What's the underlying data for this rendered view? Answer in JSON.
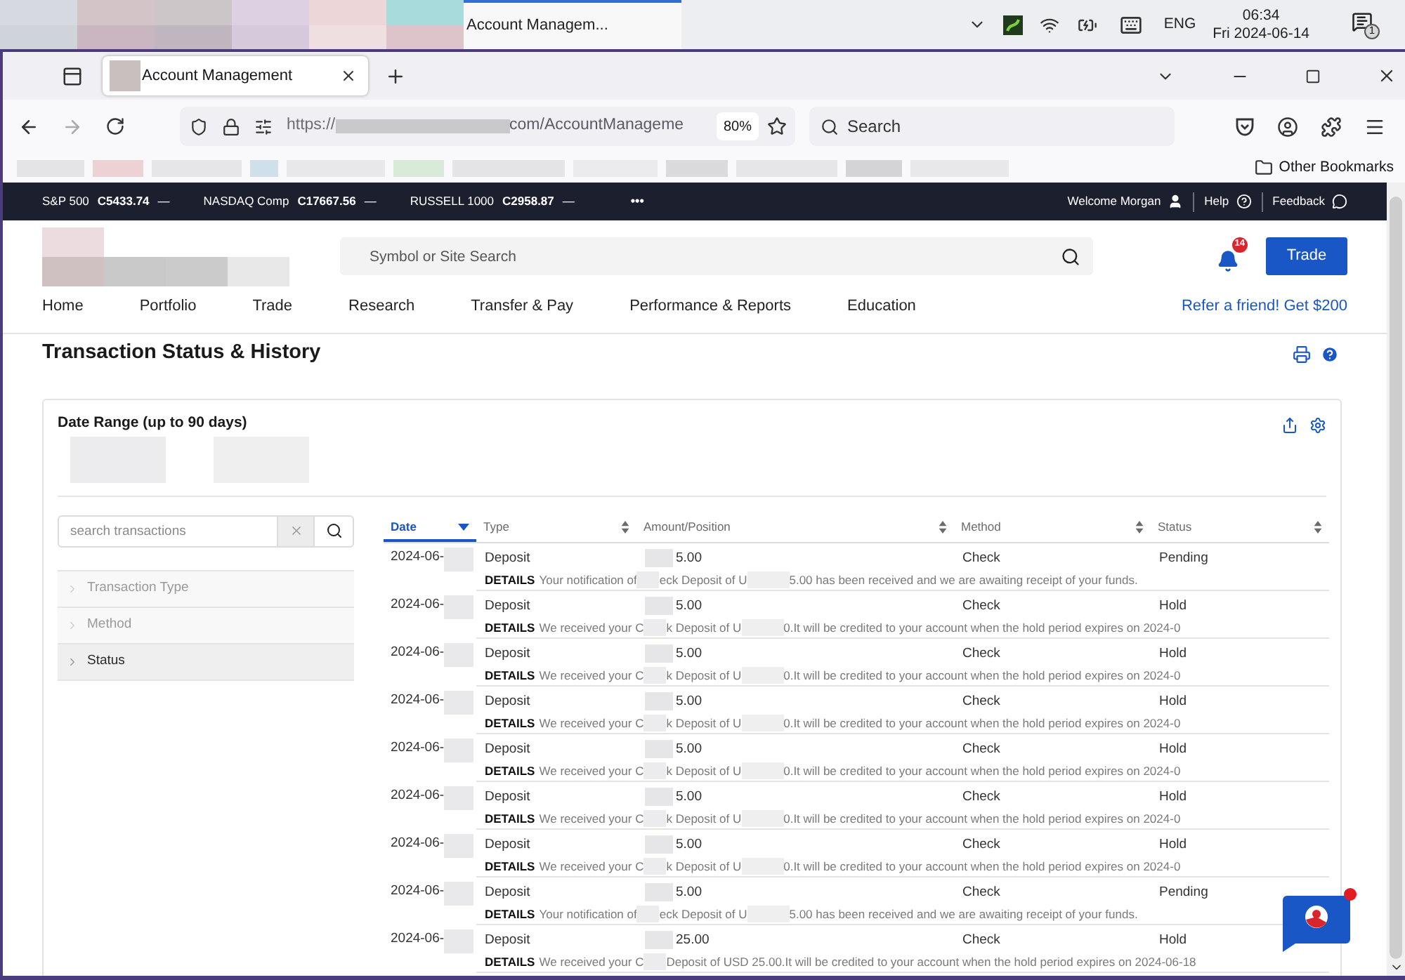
{
  "taskbar": {
    "app_button": "Account Managem...",
    "language": "ENG",
    "time": "06:34",
    "date": "Fri 2024-06-14",
    "notification_count": "1"
  },
  "browser": {
    "tab": {
      "title": "Account Management",
      "selected": true
    },
    "address": {
      "scheme": "https://",
      "path": "com/AccountManageme"
    },
    "zoom": "80%",
    "search_placeholder": "Search",
    "bookmarks": {
      "folder": "Other Bookmarks"
    }
  },
  "ticker": {
    "quotes": [
      {
        "name": "S&P 500",
        "value": "C5433.74",
        "change": "—"
      },
      {
        "name": "NASDAQ Comp",
        "value": "C17667.56",
        "change": "—"
      },
      {
        "name": "RUSSELL 1000",
        "value": "C2958.87",
        "change": "—"
      }
    ],
    "more": "•••"
  },
  "utility_links": {
    "welcome": "Welcome Morgan",
    "help": "Help",
    "feedback": "Feedback"
  },
  "header": {
    "search_placeholder": "Symbol or Site Search",
    "alert_count": "14",
    "trade_button": "Trade"
  },
  "nav": {
    "items": [
      "Home",
      "Portfolio",
      "Trade",
      "Research",
      "Transfer & Pay",
      "Performance & Reports",
      "Education"
    ],
    "promo": "Refer a friend! Get $200"
  },
  "page": {
    "title": "Transaction Status & History"
  },
  "filters": {
    "date_range_label": "Date Range (up to 90 days)",
    "search_placeholder": "search transactions",
    "facets": [
      {
        "label": "Transaction Type",
        "disabled": true
      },
      {
        "label": "Method",
        "disabled": true
      },
      {
        "label": "Status",
        "disabled": false
      }
    ]
  },
  "table": {
    "columns": [
      {
        "label": "Date",
        "selected": true
      },
      {
        "label": "Type",
        "selected": false
      },
      {
        "label": "Amount/Position",
        "selected": false
      },
      {
        "label": "Method",
        "selected": false
      },
      {
        "label": "Status",
        "selected": false
      }
    ],
    "rows": [
      {
        "date": "2024-06-",
        "type": "Deposit",
        "amount": "5.00",
        "method": "Check",
        "status": "Pending",
        "details_label": "DETAILS",
        "details": [
          "Your notification of",
          "eck Deposit of U",
          "5.00 has been received and we are awaiting receipt of your funds."
        ]
      },
      {
        "date": "2024-06-",
        "type": "Deposit",
        "amount": "5.00",
        "method": "Check",
        "status": "Hold",
        "details_label": "DETAILS",
        "details": [
          "We received your C",
          "k Deposit of U",
          "0.It will be credited to your account when the hold period expires on 2024-0"
        ]
      },
      {
        "date": "2024-06-",
        "type": "Deposit",
        "amount": "5.00",
        "method": "Check",
        "status": "Hold",
        "details_label": "DETAILS",
        "details": [
          "We received your C",
          "k Deposit of U",
          "0.It will be credited to your account when the hold period expires on 2024-0"
        ]
      },
      {
        "date": "2024-06-",
        "type": "Deposit",
        "amount": "5.00",
        "method": "Check",
        "status": "Hold",
        "details_label": "DETAILS",
        "details": [
          "We received your C",
          "k Deposit of U",
          "0.It will be credited to your account when the hold period expires on 2024-0"
        ]
      },
      {
        "date": "2024-06-",
        "type": "Deposit",
        "amount": "5.00",
        "method": "Check",
        "status": "Hold",
        "details_label": "DETAILS",
        "details": [
          "We received your C",
          "k Deposit of U",
          "0.It will be credited to your account when the hold period expires on 2024-0"
        ]
      },
      {
        "date": "2024-06-",
        "type": "Deposit",
        "amount": "5.00",
        "method": "Check",
        "status": "Hold",
        "details_label": "DETAILS",
        "details": [
          "We received your C",
          "k Deposit of U",
          "0.It will be credited to your account when the hold period expires on 2024-0"
        ]
      },
      {
        "date": "2024-06-",
        "type": "Deposit",
        "amount": "5.00",
        "method": "Check",
        "status": "Hold",
        "details_label": "DETAILS",
        "details": [
          "We received your C",
          "k Deposit of U",
          "0.It will be credited to your account when the hold period expires on 2024-0"
        ]
      },
      {
        "date": "2024-06-",
        "type": "Deposit",
        "amount": "5.00",
        "method": "Check",
        "status": "Pending",
        "details_label": "DETAILS",
        "details": [
          "Your notification of",
          "eck Deposit of U",
          "5.00 has been received and we are awaiting receipt of your funds."
        ]
      },
      {
        "date": "2024-06-",
        "type": "Deposit",
        "amount": "25.00",
        "method": "Check",
        "status": "Hold",
        "details_label": "DETAILS",
        "details": [
          "We received your C",
          "Deposit of USD 25.00.It will be credited to your account when the hold period expires on 2024-06-18"
        ]
      }
    ]
  }
}
